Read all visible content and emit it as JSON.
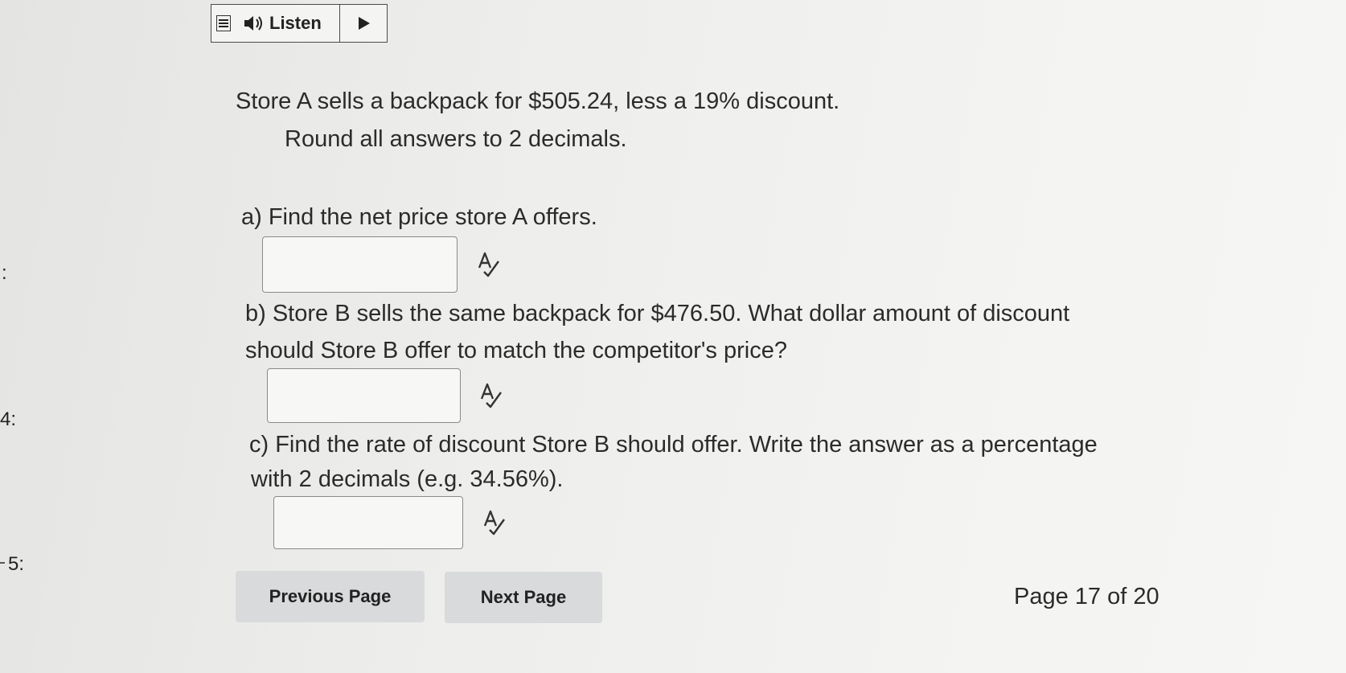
{
  "toolbar": {
    "listen_label": "Listen",
    "icons": [
      "menu-icon",
      "speaker-icon",
      "play-icon"
    ]
  },
  "question": {
    "intro_line1": "Store A sells a backpack for $505.24, less a 19% discount.",
    "intro_line2": "Round all answers to 2 decimals.",
    "part_a": {
      "prompt": "a) Find the net price store A offers.",
      "answer": ""
    },
    "part_b": {
      "prompt_line1": "b) Store B sells the same backpack for $476.50. What dollar amount of discount",
      "prompt_line2": "should Store B offer to match the competitor's price?",
      "answer": ""
    },
    "part_c": {
      "prompt_line1": "c) Find the rate of discount Store B should offer. Write the answer as a percentage",
      "prompt_line2": "with 2 decimals (e.g. 34.56%).",
      "answer": ""
    }
  },
  "side_nav": {
    "label_colon": ":",
    "label_4": "4:",
    "label_5": "5:"
  },
  "navigation": {
    "previous_label": "Previous Page",
    "next_label": "Next Page",
    "page_indicator": "Page 17 of 20"
  }
}
